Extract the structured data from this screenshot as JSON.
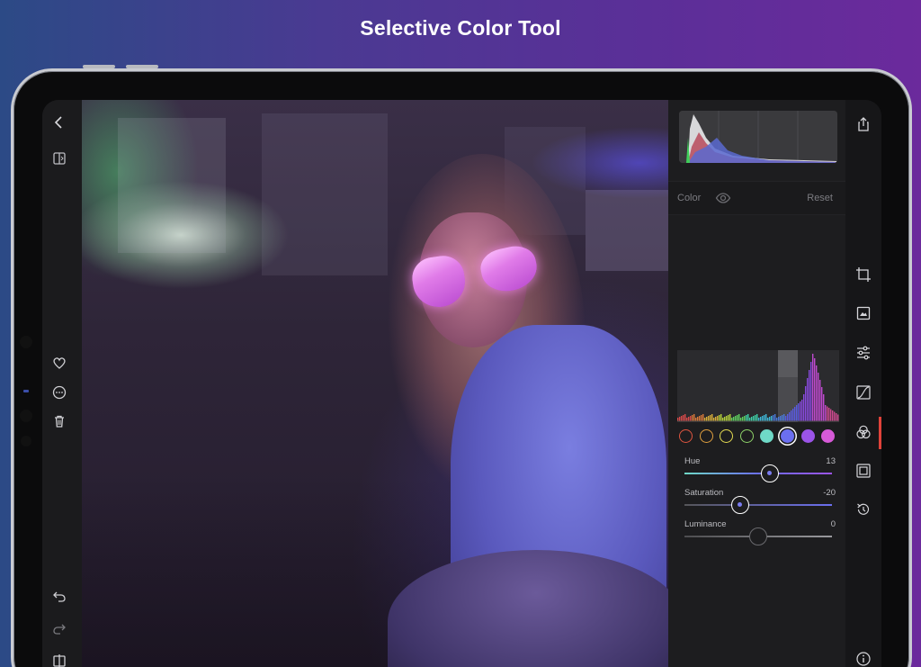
{
  "headline": "Selective Color Tool",
  "colors": {
    "accent": "#7a7cf0",
    "active_tool": "#e0423a",
    "panel_bg": "#1d1d1f",
    "text_dim": "#7b7b80"
  },
  "left_toolbar": {
    "items": [
      {
        "name": "back-icon"
      },
      {
        "name": "compare-icon"
      },
      {
        "name": "heart-icon"
      },
      {
        "name": "more-icon"
      },
      {
        "name": "trash-icon"
      },
      {
        "name": "undo-icon"
      },
      {
        "name": "redo-icon"
      },
      {
        "name": "split-view-icon"
      }
    ]
  },
  "color_panel": {
    "section_label": "Color",
    "reset_label": "Reset",
    "visibility_icon": "eye-icon",
    "swatches": [
      {
        "name": "red",
        "color": "#e0553f",
        "filled": false
      },
      {
        "name": "orange",
        "color": "#e0a03f",
        "filled": false
      },
      {
        "name": "yellow",
        "color": "#e6dc52",
        "filled": false
      },
      {
        "name": "green",
        "color": "#8fd46a",
        "filled": false
      },
      {
        "name": "aqua",
        "color": "#6fd9c7",
        "filled": true
      },
      {
        "name": "blue",
        "color": "#6b6ff0",
        "filled": true,
        "selected": true
      },
      {
        "name": "purple",
        "color": "#9b54e8",
        "filled": true
      },
      {
        "name": "magenta",
        "color": "#d75ad8",
        "filled": true
      }
    ],
    "sliders": [
      {
        "label": "Hue",
        "value": "13",
        "level": 0.58
      },
      {
        "label": "Saturation",
        "value": "-20",
        "level": 0.38
      },
      {
        "label": "Luminance",
        "value": "0",
        "level": 0.5
      }
    ]
  },
  "right_toolbar": {
    "items": [
      {
        "name": "share-icon"
      },
      {
        "name": "crop-icon"
      },
      {
        "name": "presets-icon"
      },
      {
        "name": "adjust-icon"
      },
      {
        "name": "curves-icon"
      },
      {
        "name": "selective-color-icon",
        "active": true
      },
      {
        "name": "vignette-icon"
      },
      {
        "name": "history-icon"
      },
      {
        "name": "info-icon"
      }
    ]
  }
}
